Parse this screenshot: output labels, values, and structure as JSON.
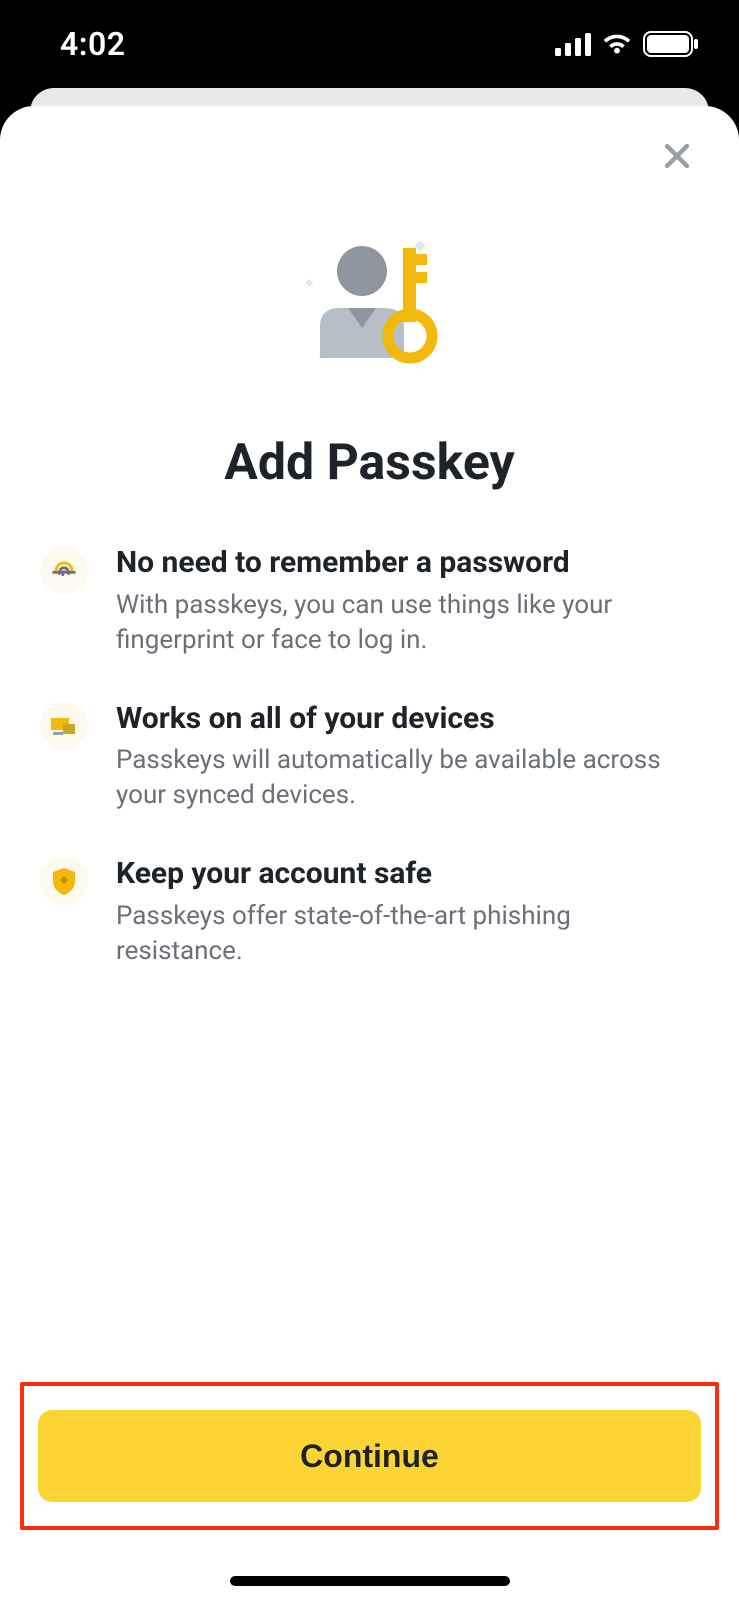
{
  "status": {
    "time": "4:02"
  },
  "sheet": {
    "title": "Add Passkey",
    "features": [
      {
        "title": "No need to remember a password",
        "desc": "With passkeys, you can use things like your fingerprint or face to log in."
      },
      {
        "title": "Works on all of your devices",
        "desc": "Passkeys will automatically be available across your synced devices."
      },
      {
        "title": "Keep your account safe",
        "desc": "Passkeys offer state-of-the-art phishing resistance."
      }
    ],
    "continue_label": "Continue"
  }
}
